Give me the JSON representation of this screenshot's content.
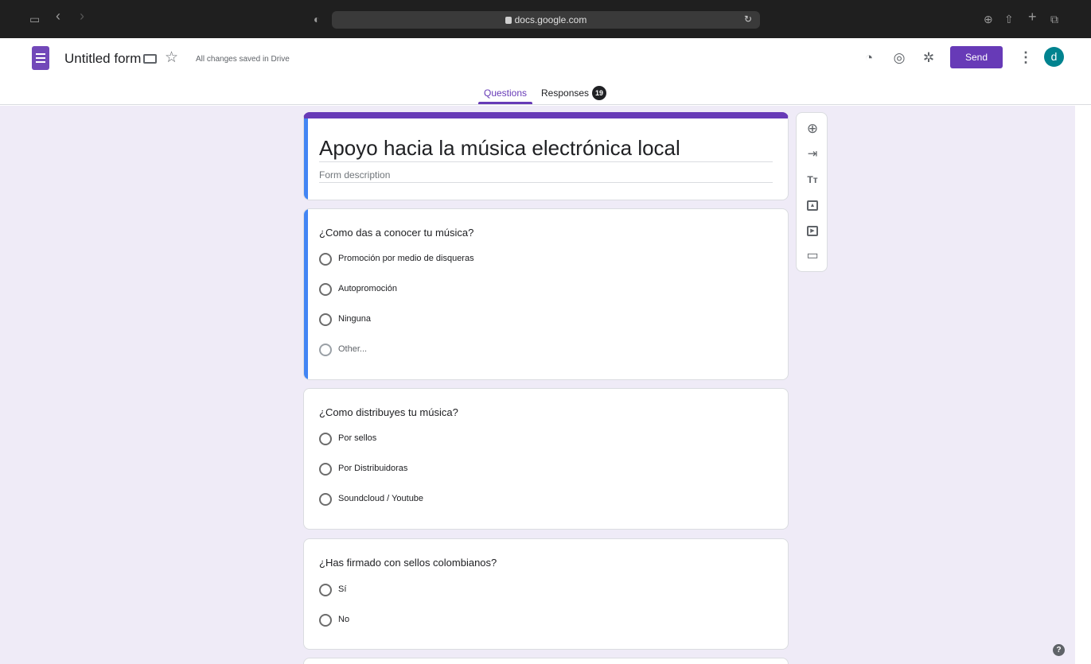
{
  "browser": {
    "url": "docs.google.com",
    "sidebar_icon": "sidebar-icon",
    "back_icon": "‹",
    "forward_icon": "›",
    "shield_icon": "◐",
    "reload_icon": "↻",
    "download_icon": "⊕",
    "share_icon": "⇧",
    "new_tab_icon": "+",
    "tabs_icon": "⧉"
  },
  "header": {
    "title": "Untitled form",
    "saved_status": "All changes saved in Drive",
    "send_label": "Send",
    "avatar_initial": "d",
    "star_icon": "☆",
    "palette_icon": "◔",
    "eye_icon": "◎",
    "gear_icon": "✲",
    "more_icon": "⋮"
  },
  "tabs": {
    "questions": "Questions",
    "responses": "Responses",
    "responses_count": "19"
  },
  "form": {
    "heading": "Apoyo hacia la música electrónica local",
    "description_placeholder": "Form description"
  },
  "questions": [
    {
      "title": "¿Como das a conocer tu música?",
      "options": [
        "Promoción por medio de disqueras",
        "Autopromoción",
        "Ninguna",
        "Other..."
      ]
    },
    {
      "title": "¿Como distribuyes tu música?",
      "options": [
        "Por sellos",
        "Por Distribuidoras",
        "Soundcloud / Youtube"
      ]
    },
    {
      "title": "¿Has firmado con sellos colombianos?",
      "options": [
        "Sí",
        "No"
      ]
    }
  ],
  "toolbar": {
    "add_question_icon": "⊕",
    "import_icon": "⇥",
    "title_icon": "Tт",
    "image_icon": "▲",
    "video_icon": "▶",
    "section_icon": "▭"
  },
  "help_icon": "?"
}
